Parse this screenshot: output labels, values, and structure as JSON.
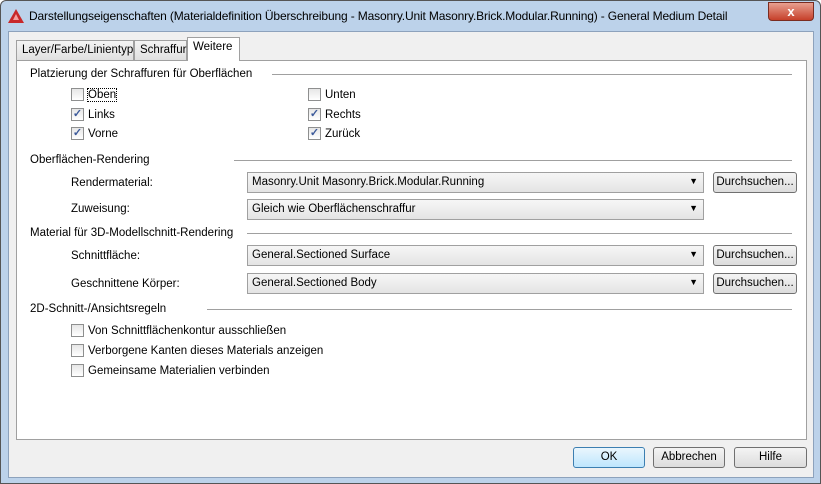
{
  "window": {
    "title": "Darstellungseigenschaften (Materialdefinition Überschreibung - Masonry.Unit Masonry.Brick.Modular.Running) - General Medium Detail",
    "close_label": "x",
    "icon": "autocad-logo-icon"
  },
  "tabs": [
    {
      "label": "Layer/Farbe/Linientyp"
    },
    {
      "label": "Schraffur"
    },
    {
      "label": "Weitere",
      "active": true
    }
  ],
  "placement": {
    "heading": "Platzierung der Schraffuren für Oberflächen",
    "options": [
      {
        "label": "Oben",
        "checked": false
      },
      {
        "label": "Links",
        "checked": true
      },
      {
        "label": "Vorne",
        "checked": true
      },
      {
        "label": "Unten",
        "checked": false
      },
      {
        "label": "Rechts",
        "checked": true
      },
      {
        "label": "Zurück",
        "checked": true
      }
    ]
  },
  "surface": {
    "heading": "Oberflächen-Rendering",
    "render_label": "Rendermaterial:",
    "render_value": "Masonry.Unit Masonry.Brick.Modular.Running",
    "assign_label": "Zuweisung:",
    "assign_value": "Gleich wie Oberflächenschraffur",
    "browse": "Durchsuchen..."
  },
  "section3d": {
    "heading": "Material für 3D-Modellschnitt-Rendering",
    "surface_label": "Schnittfläche:",
    "surface_value": "General.Sectioned Surface",
    "body_label": "Geschnittene Körper:",
    "body_value": "General.Sectioned Body",
    "browse": "Durchsuchen..."
  },
  "rules2d": {
    "heading": "2D-Schnitt-/Ansichtsregeln",
    "options": [
      {
        "label": "Von Schnittflächenkontur ausschließen",
        "checked": false
      },
      {
        "label": "Verborgene Kanten dieses Materials anzeigen",
        "checked": false
      },
      {
        "label": "Gemeinsame Materialien verbinden",
        "checked": false
      }
    ]
  },
  "buttons": {
    "ok": "OK",
    "cancel": "Abbrechen",
    "help": "Hilfe"
  }
}
